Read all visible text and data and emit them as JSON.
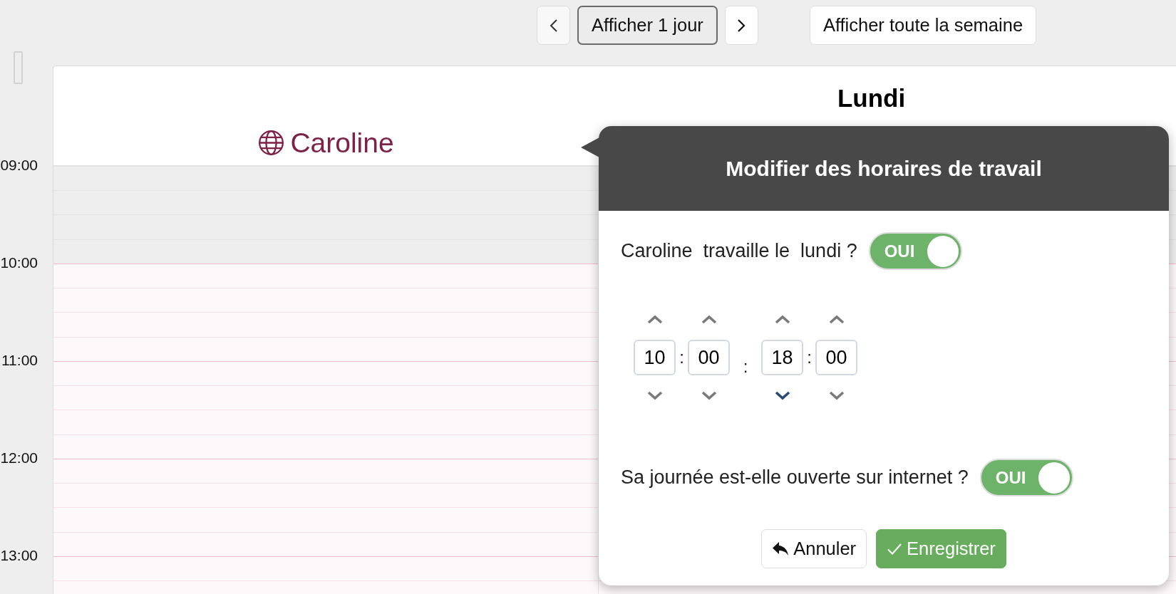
{
  "toolbar": {
    "view_buttons": [
      {
        "label": "Afficher 1 jour",
        "selected": true
      },
      {
        "label": "Afficher toute la semaine",
        "selected": false
      }
    ]
  },
  "calendar": {
    "day": "Lundi",
    "time_labels": [
      "09:00",
      "10:00",
      "11:00",
      "12:00",
      "13:00"
    ],
    "columns": [
      {
        "name": "Caroline",
        "online": true,
        "hours_available": [
          false,
          true,
          true,
          true,
          true
        ]
      },
      {
        "hours_available": [
          false,
          true,
          true,
          true,
          true
        ]
      }
    ]
  },
  "popover": {
    "title": "Modifier des horaires de travail",
    "question": "Caroline  travaille le  lundi ?",
    "works_toggle": {
      "label": "OUI",
      "on": true
    },
    "time_spinners": [
      {
        "kind": "field",
        "value": "10",
        "down_active": false
      },
      {
        "kind": "colon",
        "text": ":"
      },
      {
        "kind": "field",
        "value": "00",
        "down_active": false
      },
      {
        "kind": "range_separator",
        "text": ":"
      },
      {
        "kind": "field",
        "value": "18",
        "down_active": true
      },
      {
        "kind": "colon",
        "text": ":"
      },
      {
        "kind": "field",
        "value": "00",
        "down_active": false
      }
    ],
    "online_question": "Sa journée est-elle ouverte sur internet ?",
    "online_toggle": {
      "label": "OUI",
      "on": true
    },
    "buttons": [
      {
        "kind": "cancel",
        "label": "Annuler"
      },
      {
        "kind": "save",
        "label": "Enregistrer"
      }
    ]
  }
}
